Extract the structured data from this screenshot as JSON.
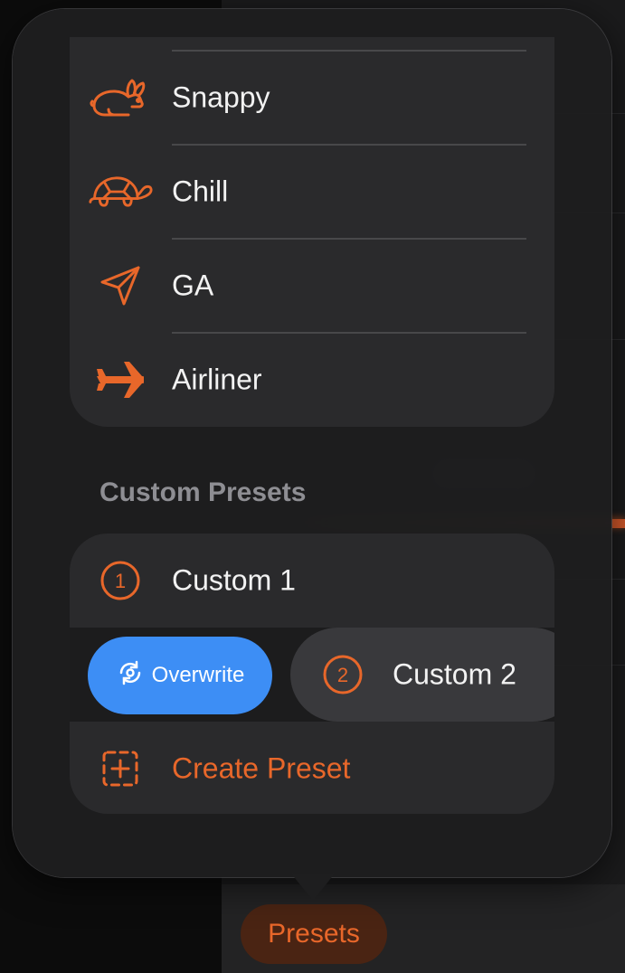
{
  "menu": {
    "builtin_presets": [
      {
        "label": "Snappy",
        "icon": "rabbit-icon"
      },
      {
        "label": "Chill",
        "icon": "turtle-icon"
      },
      {
        "label": "GA",
        "icon": "paper-plane-icon"
      },
      {
        "label": "Airliner",
        "icon": "airplane-icon"
      }
    ],
    "custom_section_title": "Custom Presets",
    "custom_presets": [
      {
        "label": "Custom 1",
        "number": "1"
      },
      {
        "label": "Custom 2",
        "number": "2"
      }
    ],
    "overwrite_label": "Overwrite",
    "create_label": "Create Preset"
  },
  "tabbar": {
    "presets_label": "Presets"
  },
  "colors": {
    "accent": "#e8672a",
    "action_blue": "#3d8ef5",
    "text": "#f2f2f2",
    "secondary_text": "#8e8e93"
  }
}
